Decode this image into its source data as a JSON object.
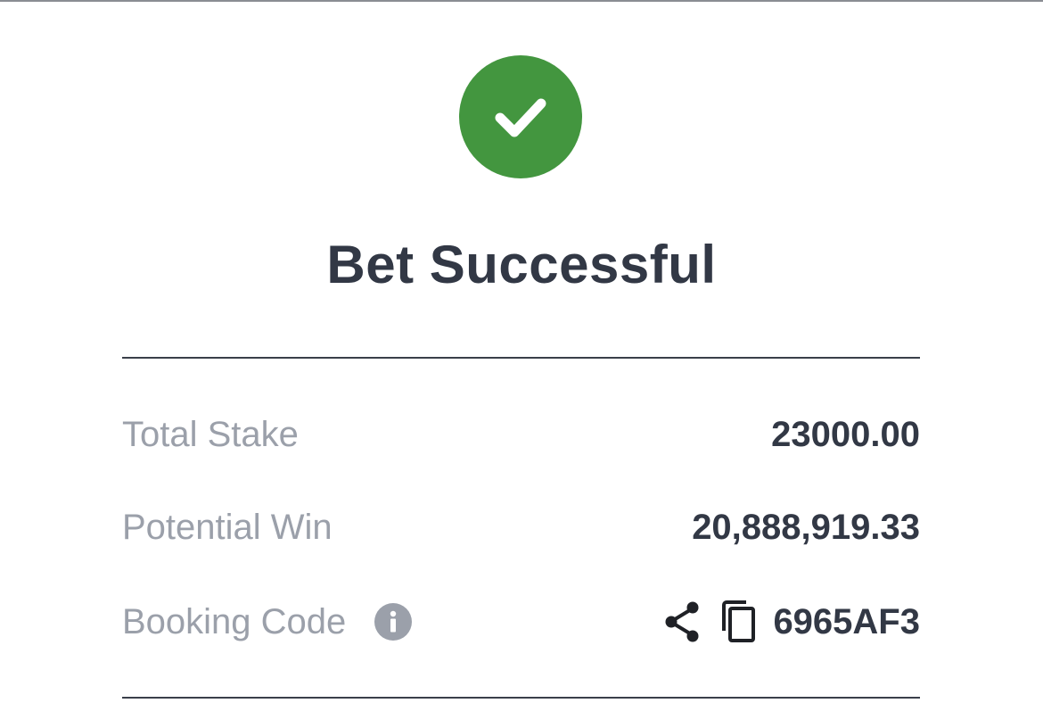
{
  "header": {
    "status_icon": "checkmark-circle-icon",
    "title": "Bet Successful"
  },
  "summary": {
    "total_stake_label": "Total Stake",
    "total_stake_value": "23000.00",
    "potential_win_label": "Potential Win",
    "potential_win_value": "20,888,919.33",
    "booking_code_label": "Booking Code",
    "booking_code_value": "6965AF3",
    "icons": {
      "info": "info-icon",
      "share": "share-icon",
      "copy": "copy-icon"
    }
  },
  "colors": {
    "success": "#43963f",
    "text_primary": "#323845",
    "text_secondary": "#9ba0aa",
    "divider": "#3a3f4a"
  }
}
